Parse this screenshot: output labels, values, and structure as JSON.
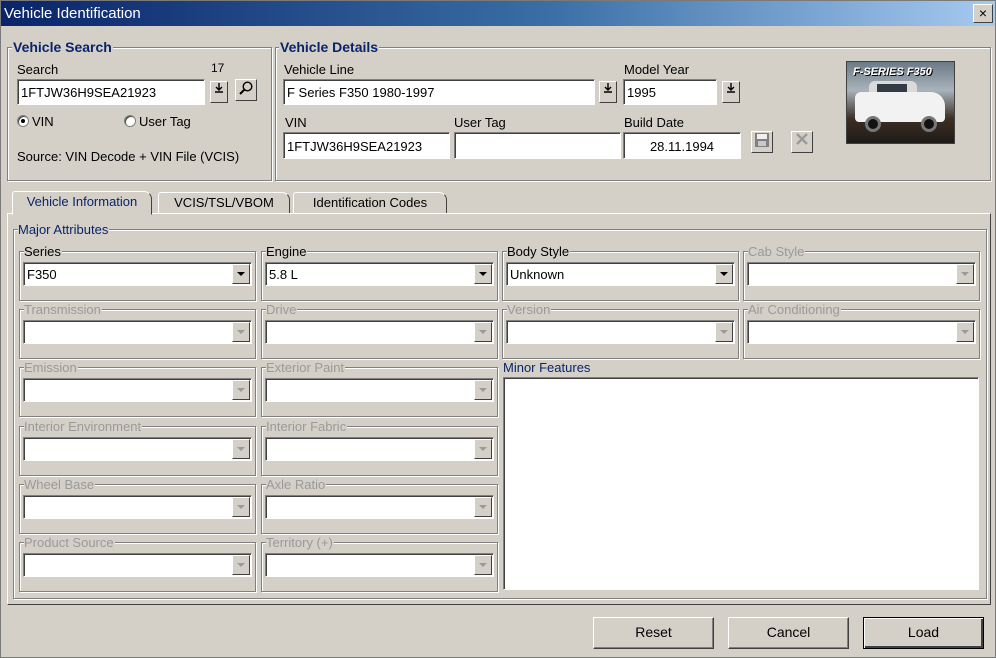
{
  "window": {
    "title": "Vehicle Identification",
    "close_glyph": "×"
  },
  "vehicle_search": {
    "title": "Vehicle Search",
    "search_label": "Search",
    "char_count": "17",
    "search_value": "1FTJW36H9SEA21923",
    "radio_vin": "VIN",
    "radio_user_tag": "User Tag",
    "selected_radio": "VIN",
    "source_text": "Source: VIN Decode + VIN File (VCIS)"
  },
  "vehicle_details": {
    "title": "Vehicle Details",
    "vehicle_line_label": "Vehicle Line",
    "vehicle_line_value": "F Series F350 1980-1997",
    "model_year_label": "Model Year",
    "model_year_value": "1995",
    "vin_label": "VIN",
    "vin_value": "1FTJW36H9SEA21923",
    "user_tag_label": "User Tag",
    "user_tag_value": "",
    "build_date_label": "Build Date",
    "build_date_value": "28.11.1994",
    "photo_caption": "F-SERIES F350"
  },
  "tabs": [
    {
      "label": "Vehicle Information",
      "active": true
    },
    {
      "label": "VCIS/TSL/VBOM",
      "active": false
    },
    {
      "label": "Identification Codes",
      "active": false
    }
  ],
  "major_attributes": {
    "title": "Major Attributes",
    "fields": [
      {
        "label": "Series",
        "value": "F350",
        "enabled": true
      },
      {
        "label": "Engine",
        "value": "5.8 L",
        "enabled": true
      },
      {
        "label": "Body Style",
        "value": "Unknown",
        "enabled": true
      },
      {
        "label": "Cab Style",
        "value": "",
        "enabled": false
      },
      {
        "label": "Transmission",
        "value": "",
        "enabled": false
      },
      {
        "label": "Drive",
        "value": "",
        "enabled": false
      },
      {
        "label": "Version",
        "value": "",
        "enabled": false
      },
      {
        "label": "Air Conditioning",
        "value": "",
        "enabled": false
      },
      {
        "label": "Emission",
        "value": "",
        "enabled": false
      },
      {
        "label": "Exterior Paint",
        "value": "",
        "enabled": false
      },
      {
        "label": "Interior Environment",
        "value": "",
        "enabled": false
      },
      {
        "label": "Interior Fabric",
        "value": "",
        "enabled": false
      },
      {
        "label": "Wheel Base",
        "value": "",
        "enabled": false
      },
      {
        "label": "Axle Ratio",
        "value": "",
        "enabled": false
      },
      {
        "label": "Product Source",
        "value": "",
        "enabled": false
      },
      {
        "label": "Territory (+)",
        "value": "",
        "enabled": false
      }
    ],
    "minor_features_label": "Minor Features"
  },
  "buttons": {
    "reset": "Reset",
    "cancel": "Cancel",
    "load": "Load"
  },
  "colors": {
    "title_start": "#0a246a",
    "title_end": "#a6caf0",
    "accent_text": "#0a246a",
    "face": "#d4d0c8",
    "disabled_text": "#9a9a9a"
  },
  "icons": [
    "close-icon",
    "dropdown-arrow-icon",
    "magnifier-icon",
    "floppy-disk-icon",
    "clear-x-icon"
  ]
}
